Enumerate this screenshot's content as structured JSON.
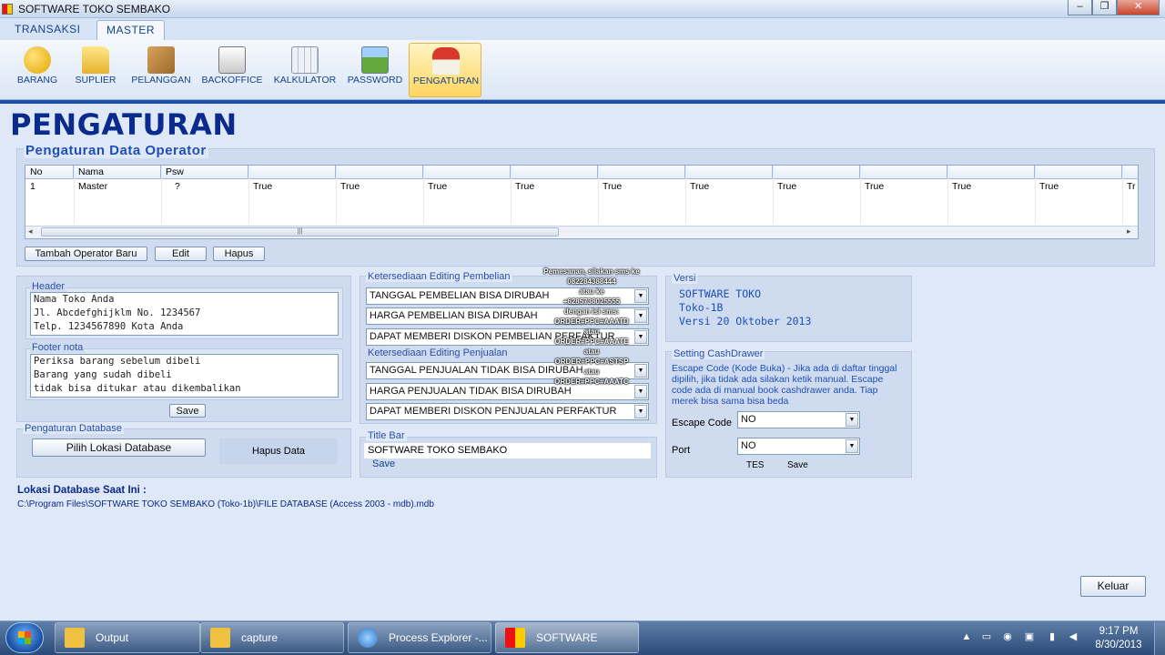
{
  "window": {
    "title": "SOFTWARE TOKO SEMBAKO",
    "controls": [
      "–",
      "❐",
      "✕"
    ]
  },
  "tabs": [
    "TRANSAKSI",
    "MASTER"
  ],
  "ribbon": [
    {
      "label": "BARANG",
      "icon": "coins-icon",
      "color": "#e8b400"
    },
    {
      "label": "SUPLIER",
      "icon": "folder-icon",
      "color": "#f2c642"
    },
    {
      "label": "PELANGGAN",
      "icon": "boxes-icon",
      "color": "#c08a3a"
    },
    {
      "label": "BACKOFFICE",
      "icon": "printer-icon",
      "color": "#e0e0e0"
    },
    {
      "label": "KALKULATOR",
      "icon": "calculator-icon",
      "color": "#d8dde6"
    },
    {
      "label": "PASSWORD",
      "icon": "lock-icon",
      "color": "#6fb34a"
    },
    {
      "label": "PENGATURAN",
      "icon": "house-icon",
      "color": "#d43a2f"
    }
  ],
  "page_title": "PENGATURAN",
  "operator": {
    "legend": "Pengaturan Data Operator",
    "columns": [
      "No",
      "Nama",
      "Psw",
      "",
      "",
      "",
      "",
      "",
      "",
      "",
      "",
      "",
      "",
      ""
    ],
    "rows": [
      [
        "1",
        "Master",
        "?",
        "True",
        "True",
        "True",
        "True",
        "True",
        "True",
        "True",
        "True",
        "True",
        "True",
        "Tr"
      ]
    ],
    "buttons": {
      "add": "Tambah Operator Baru",
      "edit": "Edit",
      "delete": "Hapus"
    },
    "scroll_grip": "|||"
  },
  "header": {
    "legend": "Header",
    "lines": [
      "Nama Toko Anda",
      "Jl. Abcdefghijklm No. 1234567",
      "Telp. 1234567890 Kota Anda"
    ]
  },
  "footer": {
    "legend": "Footer nota",
    "lines": [
      "Periksa barang sebelum dibeli",
      "Barang yang sudah dibeli",
      "tidak bisa ditukar atau dikembalikan"
    ],
    "save": "Save"
  },
  "database": {
    "legend": "Pengaturan Database",
    "choose": "Pilih Lokasi Database",
    "delete": "Hapus Data"
  },
  "purchase": {
    "legend": "Ketersediaan Editing Pembelian",
    "options": [
      "TANGGAL PEMBELIAN BISA DIRUBAH",
      "HARGA PEMBELIAN BISA DIRUBAH",
      "DAPAT MEMBERI DISKON PEMBELIAN PERFAKTUR"
    ]
  },
  "sales": {
    "legend": "Ketersediaan Editing Penjualan",
    "options": [
      "TANGGAL PENJUALAN TIDAK BISA DIRUBAH",
      "HARGA PENJUALAN TIDAK BISA DIRUBAH",
      "DAPAT MEMBERI DISKON PENJUALAN PERFAKTUR"
    ]
  },
  "titlebar_setting": {
    "legend": "Title Bar",
    "value": "SOFTWARE TOKO SEMBAKO",
    "save": "Save"
  },
  "version": {
    "legend": "Versi",
    "lines": [
      "SOFTWARE TOKO",
      "Toko-1B",
      "Versi 20 Oktober 2013"
    ]
  },
  "cashdrawer": {
    "legend": "Setting CashDrawer",
    "description": "Escape Code (Kode Buka) - Jika ada di daftar tinggal dipilih, jika tidak ada silakan ketik manual. Escape code ada di manual book cashdrawer anda. Tiap merek bisa sama bisa beda",
    "escape_label": "Escape Code",
    "escape_value": "NO",
    "port_label": "Port",
    "port_value": "NO",
    "test": "TES",
    "save": "Save"
  },
  "db_location": {
    "label": "Lokasi Database Saat Ini :",
    "path": "C:\\Program Files\\SOFTWARE TOKO SEMBAKO (Toko-1b)\\FILE DATABASE (Access 2003 - mdb).mdb"
  },
  "exit": "Keluar",
  "watermark": [
    "Pemesanan, silakan sms ke",
    "082284388444",
    "atau ke",
    "+6285738025555",
    "dengan isi sms:",
    "ORDER#PPC#AAATD",
    "atau",
    "ORDER#PPC#AAATE",
    "atau",
    "ORDER#PPC#ASTSP",
    "atau",
    "ORDER#PPC#AAATC"
  ],
  "taskbar": {
    "items": [
      {
        "label": "Output",
        "color": "#f0c040"
      },
      {
        "label": "capture",
        "color": "#f0c040"
      },
      {
        "label": "Process Explorer -...",
        "color": "#5aa0e6"
      },
      {
        "label": "SOFTWARE TOKO...",
        "color": "#e22"
      }
    ],
    "time": "9:17 PM",
    "date": "8/30/2013"
  }
}
